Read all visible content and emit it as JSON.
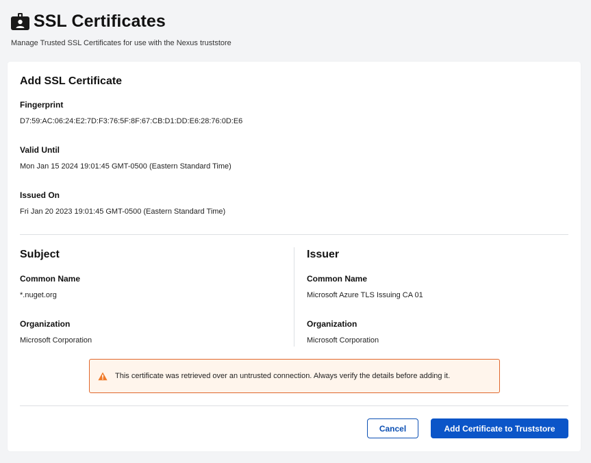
{
  "header": {
    "title": "SSL Certificates",
    "subtitle": "Manage Trusted SSL Certificates for use with the Nexus truststore",
    "icon": "badge-id-icon"
  },
  "card": {
    "title": "Add SSL Certificate",
    "fingerprint": {
      "label": "Fingerprint",
      "value": "D7:59:AC:06:24:E2:7D:F3:76:5F:8F:67:CB:D1:DD:E6:28:76:0D:E6"
    },
    "valid_until": {
      "label": "Valid Until",
      "value": "Mon Jan 15 2024 19:01:45 GMT-0500 (Eastern Standard Time)"
    },
    "issued_on": {
      "label": "Issued On",
      "value": "Fri Jan 20 2023 19:01:45 GMT-0500 (Eastern Standard Time)"
    },
    "subject": {
      "title": "Subject",
      "common_name_label": "Common Name",
      "common_name": "*.nuget.org",
      "organization_label": "Organization",
      "organization": "Microsoft Corporation"
    },
    "issuer": {
      "title": "Issuer",
      "common_name_label": "Common Name",
      "common_name": "Microsoft Azure TLS Issuing CA 01",
      "organization_label": "Organization",
      "organization": "Microsoft Corporation"
    },
    "warning": {
      "icon": "warning-triangle-icon",
      "text": "This certificate was retrieved over an untrusted connection. Always verify the details before adding it."
    },
    "buttons": {
      "cancel": "Cancel",
      "add": "Add Certificate to Truststore"
    }
  },
  "colors": {
    "primary": "#0b55c8",
    "warning_border": "#e0662a",
    "warning_bg": "#fff5ec",
    "warning_icon": "#f07a28"
  }
}
